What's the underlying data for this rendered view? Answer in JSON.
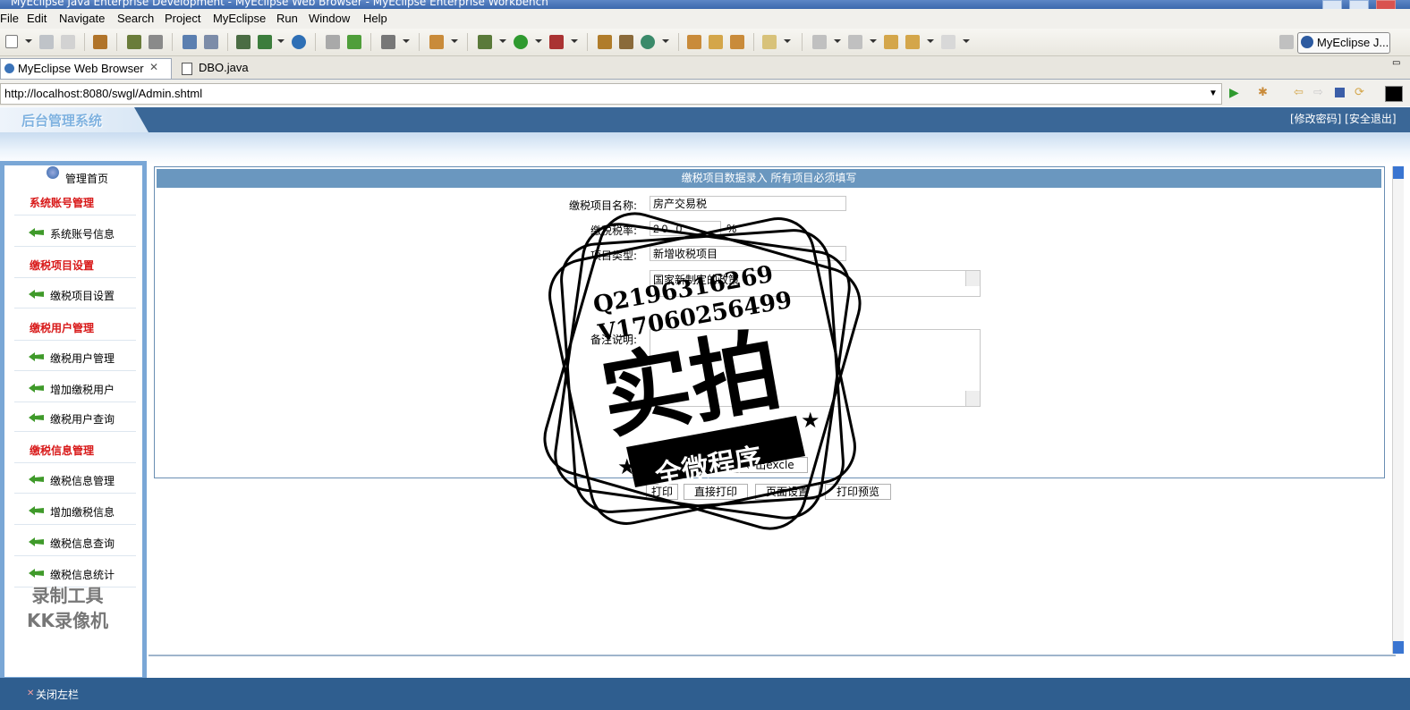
{
  "window": {
    "title": "MyEclipse Java Enterprise Development - MyEclipse Web Browser - MyEclipse Enterprise Workbench"
  },
  "menu": [
    "File",
    "Edit",
    "Navigate",
    "Search",
    "Project",
    "MyEclipse",
    "Run",
    "Window",
    "Help"
  ],
  "perspective": {
    "label": "MyEclipse J..."
  },
  "tabs": [
    {
      "label": "MyEclipse Web Browser"
    },
    {
      "label": "DBO.java"
    }
  ],
  "address": {
    "url": "http://localhost:8080/swgl/Admin.shtml"
  },
  "app": {
    "title": "后台管理系统",
    "links": "[修改密码] [安全退出]",
    "close_sidebar": "关闭左栏"
  },
  "sidebar": {
    "home": "管理首页",
    "sections": [
      {
        "title": "系统账号管理",
        "items": [
          "系统账号信息"
        ]
      },
      {
        "title": "缴税项目设置",
        "items": [
          "缴税项目设置"
        ]
      },
      {
        "title": "缴税用户管理",
        "items": [
          "缴税用户管理",
          "增加缴税用户",
          "缴税用户查询"
        ]
      },
      {
        "title": "缴税信息管理",
        "items": [
          "缴税信息管理",
          "增加缴税信息",
          "缴税信息查询",
          "缴税信息统计"
        ]
      }
    ]
  },
  "form": {
    "header": "缴税项目数据录入  所有项目必须填写",
    "name_label": "缴税项目名称:",
    "name_value": "房产交易税",
    "rate_label": "缴税税率:",
    "rate_value": "20.0",
    "rate_unit": "%",
    "type_label": "项目类型:",
    "type_value": "新增收税项目",
    "policy_value": "国家新制定的政策",
    "remark_label": "备注说明:",
    "export_button": "导出excle",
    "buttons": [
      "打印",
      "直接打印",
      "页面设置",
      "打印预览"
    ]
  },
  "watermark": {
    "line1": "Q2196316269",
    "line2": "V17060256499",
    "main": "实拍",
    "banner": "全微程序"
  },
  "recorder": {
    "line1": "录制工具",
    "line2": "KK录像机"
  }
}
